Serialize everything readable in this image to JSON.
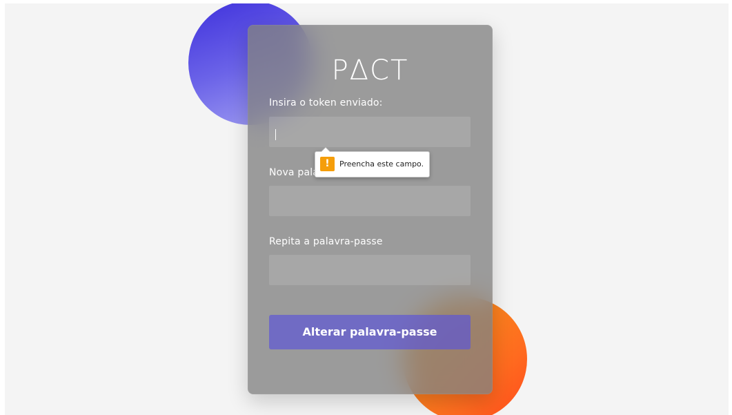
{
  "app": {
    "logo_text": "PΔCT"
  },
  "form": {
    "token_label": "Insira o token enviado:",
    "token_value": "",
    "new_password_label": "Nova palavra-passe",
    "new_password_value": "",
    "repeat_password_label": "Repita a palavra-passe",
    "repeat_password_value": "",
    "submit_label": "Alterar palavra-passe"
  },
  "validation_tooltip": {
    "icon": "warning-icon",
    "icon_glyph": "!",
    "message": "Preencha este campo."
  },
  "colors": {
    "page_background": "#f4f4f4",
    "card_background": "#8a8a8a",
    "accent_button": "#6a64d6",
    "top_circle": "#5a51e0",
    "bottom_circle": "#f58a1f",
    "warning": "#f59e0b"
  }
}
